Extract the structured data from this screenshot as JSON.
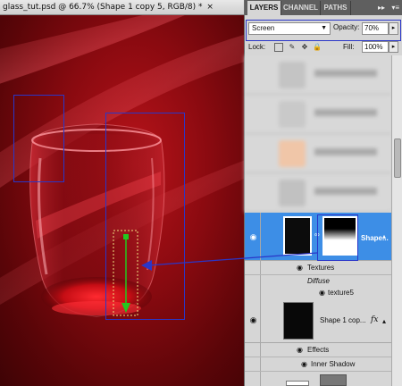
{
  "document": {
    "tab_title": "glass_tut.psd @ 66.7% (Shape 1 copy 5, RGB/8) *",
    "close_glyph": "×"
  },
  "panel": {
    "tabs": [
      {
        "label": "LAYERS",
        "active": true
      },
      {
        "label": "CHANNEL",
        "active": false
      },
      {
        "label": "PATHS",
        "active": false
      }
    ],
    "collapse_icon": "double-right-arrow",
    "menu_icon": "panel-menu-icon",
    "blend_mode": "Screen",
    "opacity_label": "Opacity:",
    "opacity_value": "70%",
    "lock_label": "Lock:",
    "fill_label": "Fill:",
    "fill_value": "100%"
  },
  "layers": {
    "selected": {
      "name": "Shape...",
      "has_mask": true
    },
    "selected_effects": {
      "group_label": "Textures",
      "sub_label": "Diffuse",
      "item_label": "texture5"
    },
    "second": {
      "name": "Shape 1 cop...",
      "fx_badge": "fx"
    },
    "second_effects": {
      "group_label": "Effects",
      "item_label": "Inner Shadow"
    }
  },
  "colors": {
    "annotation_blue": "#2a36c8",
    "selection_blue": "#3d8ee6",
    "gradient_green": "#22c81e",
    "canvas_red": "#8a0a10"
  }
}
